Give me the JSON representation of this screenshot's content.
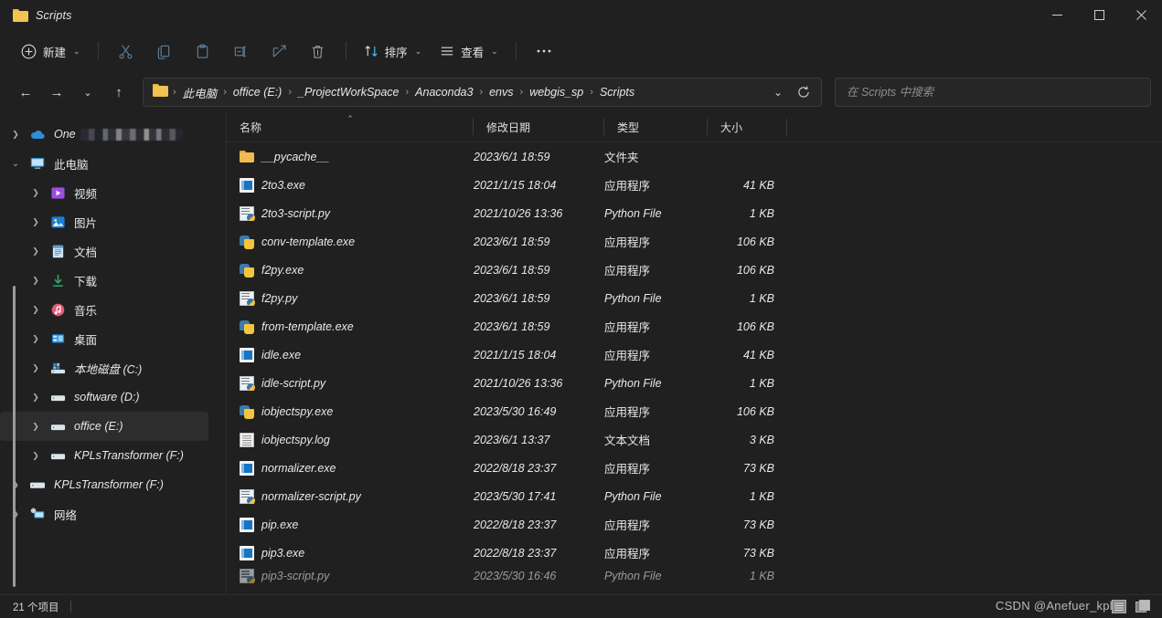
{
  "window": {
    "title": "Scripts",
    "minimize_label": "最小化",
    "maximize_label": "最大化",
    "close_label": "关闭"
  },
  "toolbar": {
    "new_label": "新建",
    "cut_label": "剪切",
    "copy_label": "复制",
    "paste_label": "粘贴",
    "rename_label": "重命名",
    "share_label": "共享",
    "delete_label": "删除",
    "sort_label": "排序",
    "view_label": "查看",
    "more_label": "..."
  },
  "navigation": {
    "back_label": "后退",
    "forward_label": "前进",
    "recent_label": "最近使用的位置",
    "up_label": "向上",
    "refresh_label": "刷新",
    "breadcrumbs": [
      "此电脑",
      "office (E:)",
      "_ProjectWorkSpace",
      "Anaconda3",
      "envs",
      "webgis_sp",
      "Scripts"
    ]
  },
  "search": {
    "placeholder": "在 Scripts 中搜索",
    "value": ""
  },
  "sidebar": {
    "items": [
      {
        "label": "One",
        "redacted": true,
        "icon": "onedrive-icon",
        "indent": 0,
        "expandable": true,
        "selected": false
      },
      {
        "label": "此电脑",
        "icon": "this-pc-icon",
        "indent": 0,
        "expandable": true,
        "expanded": true,
        "selected": false
      },
      {
        "label": "视频",
        "icon": "videos-icon",
        "indent": 1,
        "expandable": true,
        "selected": false
      },
      {
        "label": "图片",
        "icon": "pictures-icon",
        "indent": 1,
        "expandable": true,
        "selected": false
      },
      {
        "label": "文档",
        "icon": "documents-icon",
        "indent": 1,
        "expandable": true,
        "selected": false
      },
      {
        "label": "下载",
        "icon": "downloads-icon",
        "indent": 1,
        "expandable": true,
        "selected": false
      },
      {
        "label": "音乐",
        "icon": "music-icon",
        "indent": 1,
        "expandable": true,
        "selected": false
      },
      {
        "label": "桌面",
        "icon": "desktop-icon",
        "indent": 1,
        "expandable": true,
        "selected": false
      },
      {
        "label": "本地磁盘 (C:)",
        "icon": "system-drive-icon",
        "indent": 1,
        "expandable": true,
        "selected": false
      },
      {
        "label": "software (D:)",
        "icon": "drive-icon",
        "indent": 1,
        "expandable": true,
        "selected": false
      },
      {
        "label": "office (E:)",
        "icon": "drive-icon",
        "indent": 1,
        "expandable": true,
        "selected": true
      },
      {
        "label": "KPLsTransformer (F:)",
        "icon": "drive-icon",
        "indent": 1,
        "expandable": true,
        "selected": false
      },
      {
        "label": "KPLsTransformer (F:)",
        "icon": "drive-icon",
        "indent": 0,
        "expandable": true,
        "selected": false
      },
      {
        "label": "网络",
        "icon": "network-icon",
        "indent": 0,
        "expandable": true,
        "selected": false
      }
    ]
  },
  "filelist": {
    "columns": [
      {
        "key": "name",
        "label": "名称",
        "sorted": "asc"
      },
      {
        "key": "date",
        "label": "修改日期"
      },
      {
        "key": "type",
        "label": "类型"
      },
      {
        "key": "size",
        "label": "大小"
      }
    ],
    "rows": [
      {
        "name": "__pycache__",
        "date": "2023/6/1 18:59",
        "type": "文件夹",
        "size": "",
        "icon": "folder-icon"
      },
      {
        "name": "2to3.exe",
        "date": "2021/1/15 18:04",
        "type": "应用程序",
        "size": "41 KB",
        "icon": "exe-icon"
      },
      {
        "name": "2to3-script.py",
        "date": "2021/10/26 13:36",
        "type": "Python File",
        "size": "1 KB",
        "icon": "python-file-icon"
      },
      {
        "name": "conv-template.exe",
        "date": "2023/6/1 18:59",
        "type": "应用程序",
        "size": "106 KB",
        "icon": "python-exe-icon"
      },
      {
        "name": "f2py.exe",
        "date": "2023/6/1 18:59",
        "type": "应用程序",
        "size": "106 KB",
        "icon": "python-exe-icon"
      },
      {
        "name": "f2py.py",
        "date": "2023/6/1 18:59",
        "type": "Python File",
        "size": "1 KB",
        "icon": "python-file-icon"
      },
      {
        "name": "from-template.exe",
        "date": "2023/6/1 18:59",
        "type": "应用程序",
        "size": "106 KB",
        "icon": "python-exe-icon"
      },
      {
        "name": "idle.exe",
        "date": "2021/1/15 18:04",
        "type": "应用程序",
        "size": "41 KB",
        "icon": "exe-icon"
      },
      {
        "name": "idle-script.py",
        "date": "2021/10/26 13:36",
        "type": "Python File",
        "size": "1 KB",
        "icon": "python-file-icon"
      },
      {
        "name": "iobjectspy.exe",
        "date": "2023/5/30 16:49",
        "type": "应用程序",
        "size": "106 KB",
        "icon": "python-exe-icon"
      },
      {
        "name": "iobjectspy.log",
        "date": "2023/6/1 13:37",
        "type": "文本文档",
        "size": "3 KB",
        "icon": "log-file-icon"
      },
      {
        "name": "normalizer.exe",
        "date": "2022/8/18 23:37",
        "type": "应用程序",
        "size": "73 KB",
        "icon": "exe-icon"
      },
      {
        "name": "normalizer-script.py",
        "date": "2023/5/30 17:41",
        "type": "Python File",
        "size": "1 KB",
        "icon": "python-file-icon"
      },
      {
        "name": "pip.exe",
        "date": "2022/8/18 23:37",
        "type": "应用程序",
        "size": "73 KB",
        "icon": "exe-icon"
      },
      {
        "name": "pip3.exe",
        "date": "2022/8/18 23:37",
        "type": "应用程序",
        "size": "73 KB",
        "icon": "exe-icon"
      },
      {
        "name": "pip3-script.py",
        "date": "2023/5/30 16:46",
        "type": "Python File",
        "size": "1 KB",
        "icon": "python-file-icon"
      }
    ]
  },
  "statusbar": {
    "item_count": "21 个项目",
    "details_view_label": "详细信息",
    "large_icons_view_label": "大图标"
  },
  "watermark": {
    "text": "CSDN @Anefuer_kpl"
  },
  "colors": {
    "window_bg": "#202020",
    "accent": "#4cc2ff",
    "folder_yellow": "#f0bc4f",
    "text": "#e9e9e9"
  }
}
